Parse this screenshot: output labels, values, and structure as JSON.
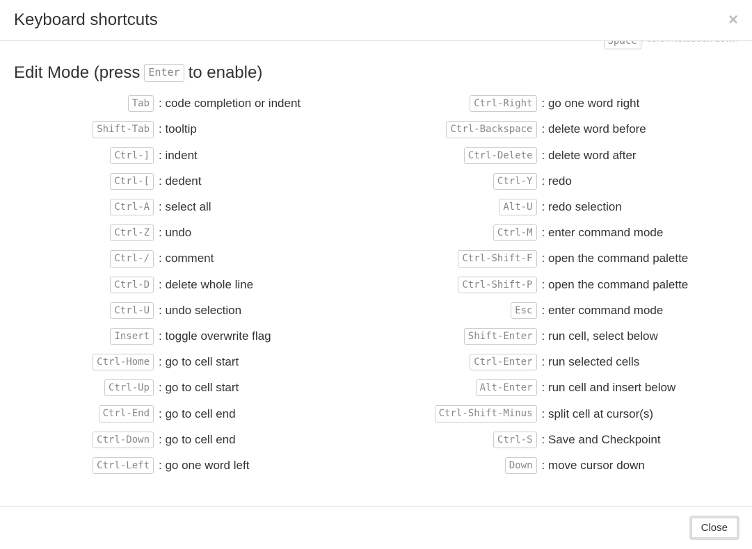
{
  "header": {
    "title": "Keyboard shortcuts",
    "close_x": "×"
  },
  "peek": {
    "key": "Space",
    "desc": ": scroll notebook down"
  },
  "section": {
    "prefix": "Edit Mode (press",
    "key": "Enter",
    "suffix": "to enable)"
  },
  "left": [
    {
      "key": "Tab",
      "desc": "code completion or indent"
    },
    {
      "key": "Shift-Tab",
      "desc": "tooltip"
    },
    {
      "key": "Ctrl-]",
      "desc": "indent"
    },
    {
      "key": "Ctrl-[",
      "desc": "dedent"
    },
    {
      "key": "Ctrl-A",
      "desc": "select all"
    },
    {
      "key": "Ctrl-Z",
      "desc": "undo"
    },
    {
      "key": "Ctrl-/",
      "desc": "comment"
    },
    {
      "key": "Ctrl-D",
      "desc": "delete whole line"
    },
    {
      "key": "Ctrl-U",
      "desc": "undo selection"
    },
    {
      "key": "Insert",
      "desc": "toggle overwrite flag"
    },
    {
      "key": "Ctrl-Home",
      "desc": "go to cell start"
    },
    {
      "key": "Ctrl-Up",
      "desc": "go to cell start"
    },
    {
      "key": "Ctrl-End",
      "desc": "go to cell end"
    },
    {
      "key": "Ctrl-Down",
      "desc": "go to cell end"
    },
    {
      "key": "Ctrl-Left",
      "desc": "go one word left"
    }
  ],
  "right": [
    {
      "key": "Ctrl-Right",
      "desc": "go one word right"
    },
    {
      "key": "Ctrl-Backspace",
      "desc": "delete word before"
    },
    {
      "key": "Ctrl-Delete",
      "desc": "delete word after"
    },
    {
      "key": "Ctrl-Y",
      "desc": "redo"
    },
    {
      "key": "Alt-U",
      "desc": "redo selection"
    },
    {
      "key": "Ctrl-M",
      "desc": "enter command mode"
    },
    {
      "key": "Ctrl-Shift-F",
      "desc": "open the command palette"
    },
    {
      "key": "Ctrl-Shift-P",
      "desc": "open the command palette"
    },
    {
      "key": "Esc",
      "desc": "enter command mode"
    },
    {
      "key": "Shift-Enter",
      "desc": "run cell, select below"
    },
    {
      "key": "Ctrl-Enter",
      "desc": "run selected cells"
    },
    {
      "key": "Alt-Enter",
      "desc": "run cell and insert below"
    },
    {
      "key": "Ctrl-Shift-Minus",
      "desc": "split cell at cursor(s)"
    },
    {
      "key": "Ctrl-S",
      "desc": "Save and Checkpoint"
    },
    {
      "key": "Down",
      "desc": "move cursor down"
    }
  ],
  "footer": {
    "close_label": "Close"
  }
}
